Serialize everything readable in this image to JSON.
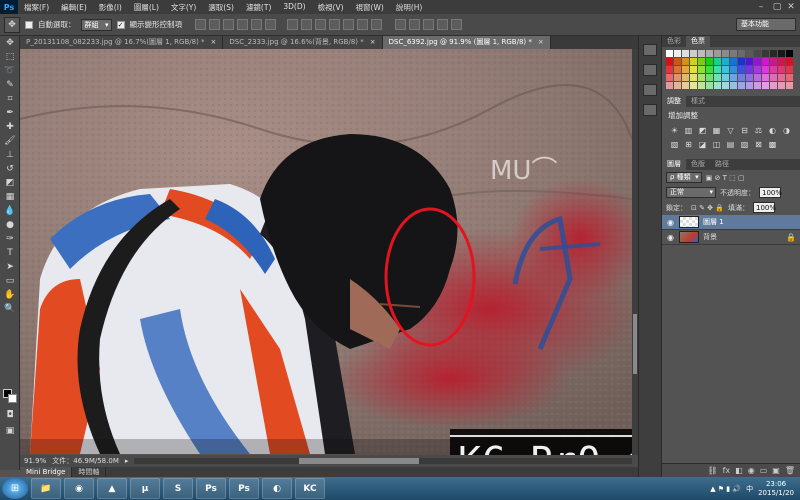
{
  "app": {
    "logo": "Ps"
  },
  "menu": [
    "檔案(F)",
    "編輯(E)",
    "影像(I)",
    "圖層(L)",
    "文字(Y)",
    "選取(S)",
    "濾鏡(T)",
    "3D(D)",
    "檢視(V)",
    "視窗(W)",
    "說明(H)"
  ],
  "window_controls": {
    "minimize": "–",
    "maximize": "▢",
    "close": "✕"
  },
  "options": {
    "tool_icon": "move-icon",
    "auto_select_label": "自動選取：",
    "auto_select_checked": "",
    "auto_select_value": "群組",
    "show_transform_label": "顯示變形控制項",
    "show_transform_checked": "✓",
    "workspace": "基本功能"
  },
  "doc_tabs": [
    {
      "label": "P_20131108_082233.jpg @ 16.7%(圖層 1, RGB/8) *",
      "close": "×",
      "active": false
    },
    {
      "label": "DSC_2333.jpg @ 16.6%(背景, RGB/8) *",
      "close": "×",
      "active": false
    },
    {
      "label": "DSC_6392.jpg @ 91.9% (圖層 1, RGB/8) *",
      "close": "×",
      "active": true
    }
  ],
  "status": {
    "zoom": "91.9%",
    "doc": "文件：46.9M/58.0M",
    "arrow": "▸"
  },
  "bottom_tabs": [
    "Mini Bridge",
    "時間軸"
  ],
  "panels": {
    "color_tabs": [
      "色彩",
      "色票"
    ],
    "adjust_tabs": [
      "調整",
      "樣式"
    ],
    "adjust_title": "增加調整",
    "adjust_icons": [
      "☀",
      "▥",
      "◩",
      "▦",
      "▽",
      "⊟",
      "⚖",
      "◐",
      "◑",
      "▧",
      "⊞",
      "◪",
      "◫",
      "▤",
      "▨",
      "⊠",
      "▩"
    ],
    "layer_tabs": [
      "圖層",
      "色版",
      "路徑"
    ],
    "kind_label": "ρ 種類",
    "blend_mode": "正常",
    "opacity_label": "不透明度：",
    "opacity": "100%",
    "lock_label": "鎖定：",
    "fill_label": "填滿：",
    "fill": "100%",
    "layers": [
      {
        "name": "圖層 1",
        "active": true,
        "locked": false
      },
      {
        "name": "背景",
        "active": false,
        "locked": true
      }
    ],
    "bottom_icons": [
      "⛓",
      "fx",
      "◧",
      "◉",
      "▭",
      "▣",
      "🗑"
    ]
  },
  "watermark": "KC PrO_dUctiON",
  "taskbar": {
    "start": "⊞",
    "apps": [
      {
        "name": "explorer",
        "label": "📁"
      },
      {
        "name": "chrome",
        "label": "◉"
      },
      {
        "name": "app3",
        "label": "▲"
      },
      {
        "name": "utorrent",
        "label": "µ"
      },
      {
        "name": "skype",
        "label": "S"
      },
      {
        "name": "photoshop-1",
        "label": "Ps"
      },
      {
        "name": "photoshop-2",
        "label": "Ps"
      },
      {
        "name": "app8",
        "label": "◐"
      },
      {
        "name": "app9",
        "label": "KC"
      }
    ],
    "tray_lang": "中",
    "time": "23:06",
    "date": "2015/1/20"
  }
}
